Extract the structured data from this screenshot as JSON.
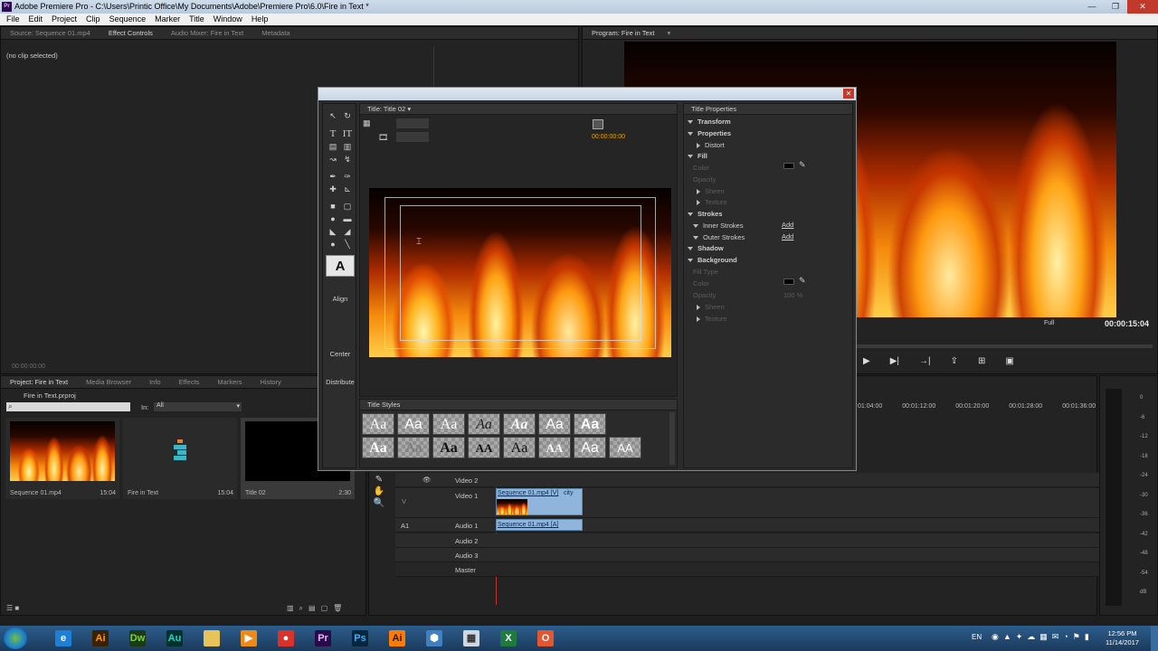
{
  "window": {
    "title": "Adobe Premiere Pro - C:\\Users\\Printic Office\\My Documents\\Adobe\\Premiere Pro\\6.0\\Fire in Text *",
    "app_icon": "Pr"
  },
  "menu": [
    "File",
    "Edit",
    "Project",
    "Clip",
    "Sequence",
    "Marker",
    "Title",
    "Window",
    "Help"
  ],
  "source_panel": {
    "tabs": [
      "Source: Sequence 01.mp4",
      "Effect Controls",
      "Audio Mixer: Fire in Text",
      "Metadata"
    ],
    "clip_status": "(no clip selected)",
    "timecode": "00:00:00:00"
  },
  "program_panel": {
    "tab": "Program: Fire in Text",
    "zoom": "Full",
    "timecode": "00:00:15:04"
  },
  "project_panel": {
    "tabs": [
      "Project: Fire in Text",
      "Media Browser",
      "Info",
      "Effects",
      "Markers",
      "History"
    ],
    "project_file": "Fire in Text.prproj",
    "in_label": "In:",
    "in_value": "All",
    "items": [
      {
        "name": "Sequence 01.mp4",
        "duration": "15:04"
      },
      {
        "name": "Fire in Text",
        "duration": "15:04"
      },
      {
        "name": "Title 02",
        "duration": "2:30"
      }
    ]
  },
  "title_designer": {
    "tab": "Title: Title 02",
    "timecode": "00:00:00:00",
    "actions": {
      "align": "Align",
      "center": "Center",
      "distribute": "Distribute"
    },
    "styles_tab": "Title Styles",
    "style_samples": [
      "Aa",
      "Aa",
      "Aa",
      "Aa",
      "Aa",
      "Aa",
      "Aa",
      "Aa",
      "Aa",
      "Aa",
      "AA",
      "Aa",
      "AA",
      "Aa",
      "AA"
    ],
    "properties_tab": "Title Properties",
    "properties": {
      "transform": "Transform",
      "properties": "Properties",
      "distort": "Distort",
      "fill": "Fill",
      "color": "Color",
      "opacity": "Opacity",
      "sheen": "Sheen",
      "texture": "Texture",
      "strokes": "Strokes",
      "inner_strokes": "Inner Strokes",
      "outer_strokes": "Outer Strokes",
      "add": "Add",
      "shadow": "Shadow",
      "background": "Background",
      "fill_type": "Fill Type",
      "bg_opacity": "100 %"
    }
  },
  "timeline": {
    "ruler": [
      "01:04:00",
      "00:01:12:00",
      "00:01:20:00",
      "00:01:28:00",
      "00:01:36:00",
      "00"
    ],
    "tracks": [
      {
        "name": "Video 2"
      },
      {
        "name": "Video 1",
        "clip": "Sequence 01.mp4 [V]",
        "fx": "city"
      },
      {
        "name": "Audio 1",
        "clip": "Sequence 01.mp4 [A]"
      },
      {
        "name": "Audio 2"
      },
      {
        "name": "Audio 3"
      },
      {
        "name": "Master"
      }
    ],
    "v_label": "V",
    "a_label": "A1"
  },
  "meters": [
    "0",
    "-6",
    "-12",
    "-18",
    "-24",
    "-30",
    "-36",
    "-42",
    "-48",
    "-54",
    "dB"
  ],
  "taskbar": {
    "apps": [
      {
        "icon": "ie-icon",
        "label": "e",
        "color": "#1d7fd6"
      },
      {
        "icon": "illustrator-icon",
        "label": "Ai",
        "color": "#3a2200",
        "fg": "#ff9a00"
      },
      {
        "icon": "dreamweaver-icon",
        "label": "Dw",
        "color": "#1b3b14",
        "fg": "#7dd23b"
      },
      {
        "icon": "audition-icon",
        "label": "Au",
        "color": "#00312e",
        "fg": "#1fd1c0"
      },
      {
        "icon": "folder-icon",
        "label": "",
        "color": "#e7c35a"
      },
      {
        "icon": "media-player-icon",
        "label": "▶",
        "color": "#f08a16"
      },
      {
        "icon": "chrome-icon",
        "label": "●",
        "color": "#d9322a"
      },
      {
        "icon": "premiere-icon",
        "label": "Pr",
        "color": "#2a0a4a",
        "fg": "#e3b6ff"
      },
      {
        "icon": "photoshop-icon",
        "label": "Ps",
        "color": "#06263e",
        "fg": "#3ab0ff"
      },
      {
        "icon": "illustrator-icon",
        "label": "Ai",
        "color": "#ff7b00",
        "fg": "#3a1300"
      },
      {
        "icon": "network-icon",
        "label": "⬢",
        "color": "#3f7fc2"
      },
      {
        "icon": "calculator-icon",
        "label": "▦",
        "color": "#cfd8e2",
        "fg": "#333"
      },
      {
        "icon": "excel-icon",
        "label": "X",
        "color": "#1f7a3d",
        "fg": "#fff"
      },
      {
        "icon": "office-icon",
        "label": "O",
        "color": "#e4572e",
        "fg": "#fff"
      }
    ],
    "lang": "EN",
    "time": "12:56 PM",
    "date": "11/14/2017"
  }
}
